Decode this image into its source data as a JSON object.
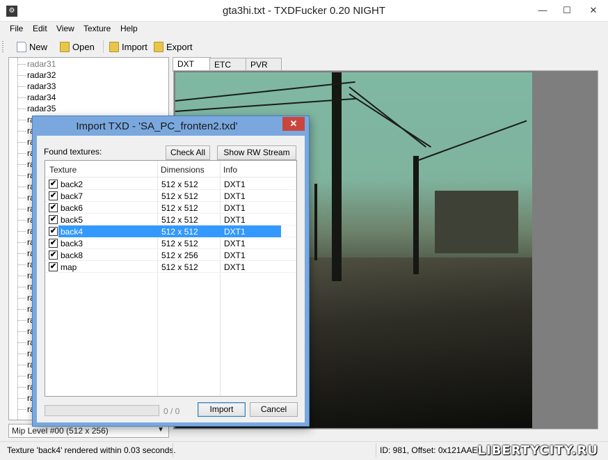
{
  "window": {
    "title": "gta3hi.txt - TXDFucker 0.20 NIGHT",
    "controls": {
      "minimize": "—",
      "maximize": "☐",
      "close": "✕"
    }
  },
  "menu": [
    "File",
    "Edit",
    "View",
    "Texture",
    "Help"
  ],
  "toolbar": {
    "new_label": "New",
    "open_label": "Open",
    "import_label": "Import",
    "export_label": "Export"
  },
  "tree": {
    "items": [
      "radar31",
      "radar32",
      "radar33",
      "radar34",
      "radar35",
      "rad",
      "rad",
      "rad",
      "rad",
      "rad",
      "rad",
      "rad",
      "rad",
      "rad",
      "rad",
      "rad",
      "rad",
      "rad",
      "rad",
      "rad",
      "rad",
      "rad",
      "rad",
      "rad",
      "rad",
      "rad",
      "rad",
      "rad",
      "rad",
      "rad",
      "rad",
      "rad"
    ]
  },
  "mip_select": {
    "value": "Mip Level #00 (512 x 256)"
  },
  "tabs": [
    "DXT",
    "ETC",
    "PVR"
  ],
  "dialog": {
    "title": "Import TXD - 'SA_PC_fronten2.txd'",
    "close_glyph": "✕",
    "found_label": "Found textures:",
    "check_all_label": "Check All",
    "show_rw_label": "Show RW Stream",
    "columns": [
      "Texture",
      "Dimensions",
      "Info"
    ],
    "rows": [
      {
        "name": "back2",
        "dims": "512 x 512",
        "info": "DXT1",
        "checked": "✔"
      },
      {
        "name": "back7",
        "dims": "512 x 512",
        "info": "DXT1",
        "checked": "✔"
      },
      {
        "name": "back6",
        "dims": "512 x 512",
        "info": "DXT1",
        "checked": "✔"
      },
      {
        "name": "back5",
        "dims": "512 x 512",
        "info": "DXT1",
        "checked": "✔"
      },
      {
        "name": "back4",
        "dims": "512 x 512",
        "info": "DXT1",
        "checked": "✔"
      },
      {
        "name": "back3",
        "dims": "512 x 512",
        "info": "DXT1",
        "checked": "✔"
      },
      {
        "name": "back8",
        "dims": "512 x 256",
        "info": "DXT1",
        "checked": "✔"
      },
      {
        "name": "map",
        "dims": "512 x 512",
        "info": "DXT1",
        "checked": "✔"
      }
    ],
    "selected_index": 4,
    "progress_text": "0 / 0",
    "import_label": "Import",
    "cancel_label": "Cancel"
  },
  "status": {
    "left": "Texture 'back4' rendered within 0.03 seconds.",
    "right": "ID: 981, Offset: 0x121AAE0",
    "watermark": "LIBERTYCITY.RU"
  },
  "colors": {
    "selection": "#3399ff",
    "dialog_frame": "#7aa8de",
    "close_red": "#c9463d"
  }
}
